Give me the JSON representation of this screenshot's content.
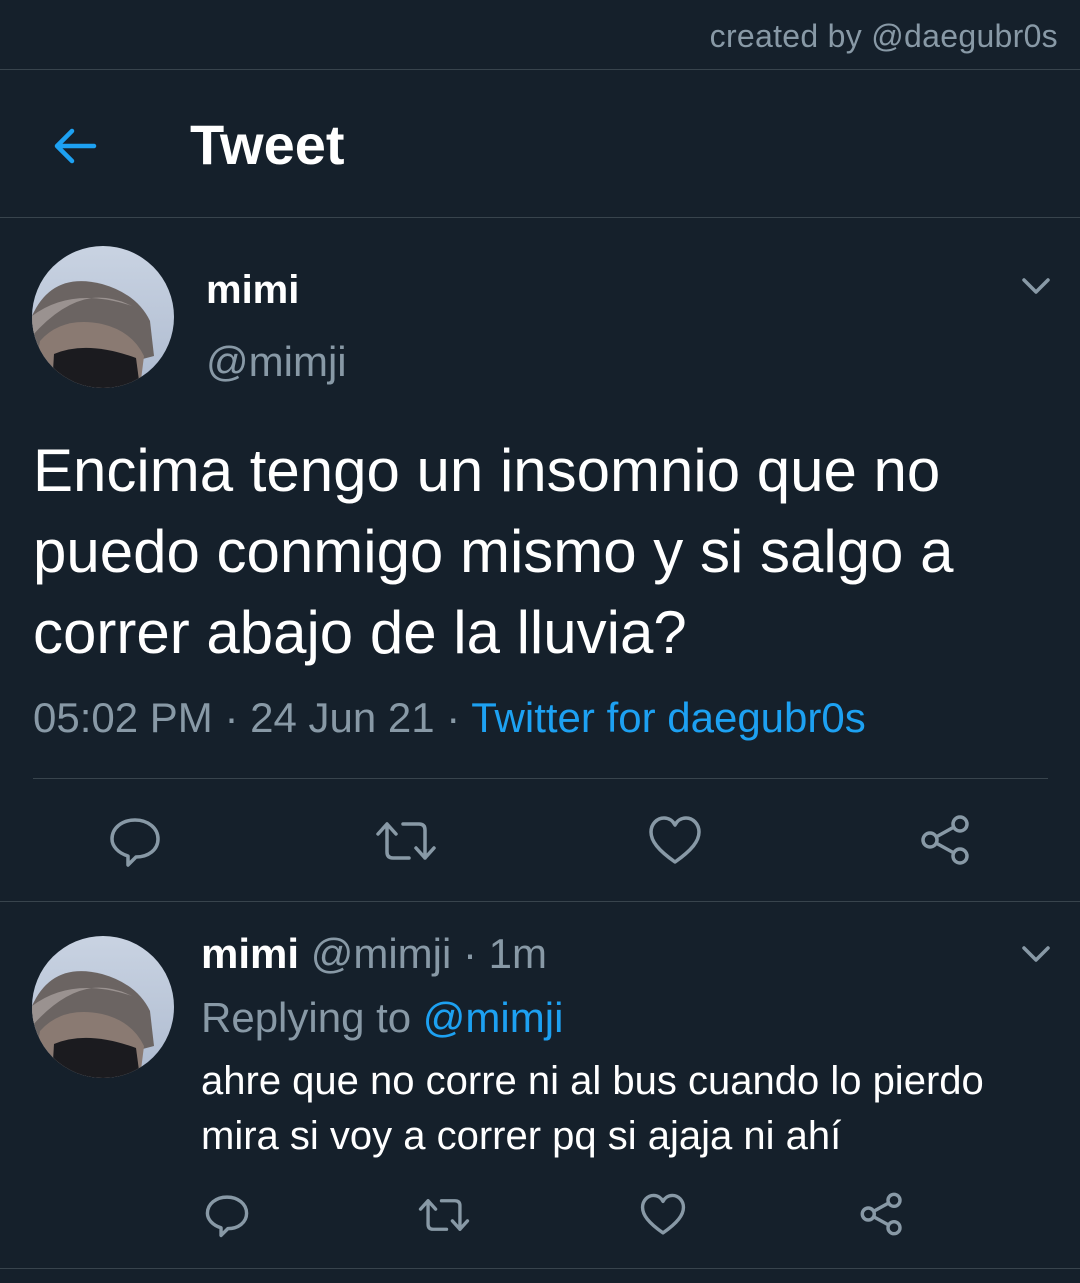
{
  "watermark": "created by @daegubr0s",
  "header": {
    "title": "Tweet",
    "back_icon": "arrow-left-icon",
    "accent": "#1da1f2"
  },
  "tweet": {
    "name": "mimi",
    "handle": "@mimji",
    "text": "Encima tengo un insomnio que no puedo conmigo mismo y si salgo a correr abajo de la lluvia?",
    "time": "05:02 PM",
    "sep1": "·",
    "date": "24 Jun 21",
    "sep2": "·",
    "source": "Twitter for daegubr0s",
    "actions": [
      "reply-icon",
      "retweet-icon",
      "like-icon",
      "share-icon"
    ]
  },
  "reply": {
    "name": "mimi",
    "handle": "@mimji",
    "sep": "·",
    "time": "1m",
    "replying_label": "Replying to",
    "replying_to": "@mimji",
    "text": "ahre que no corre ni al bus cuando lo pierdo mira si voy a correr pq si ajaja ni ahí",
    "actions": [
      "reply-icon",
      "retweet-icon",
      "like-icon",
      "share-icon"
    ]
  },
  "colors": {
    "background": "#15202b",
    "divider": "#38444d",
    "secondary_text": "#8899a6",
    "link": "#1da1f2"
  }
}
